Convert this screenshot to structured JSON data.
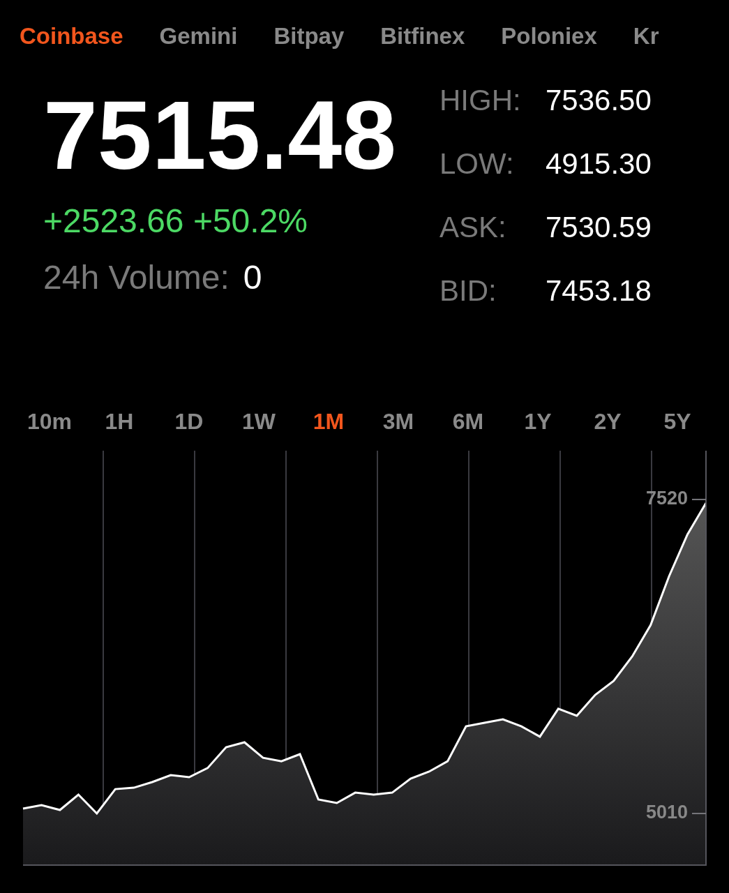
{
  "exchanges": [
    {
      "label": "Coinbase",
      "selected": true
    },
    {
      "label": "Gemini",
      "selected": false
    },
    {
      "label": "Bitpay",
      "selected": false
    },
    {
      "label": "Bitfinex",
      "selected": false
    },
    {
      "label": "Poloniex",
      "selected": false
    },
    {
      "label": "Kr",
      "selected": false
    }
  ],
  "price": "7515.48",
  "change": "+2523.66 +50.2%",
  "volume": {
    "label": "24h Volume:",
    "value": "0"
  },
  "stats": [
    {
      "label": "HIGH:",
      "value": "7536.50"
    },
    {
      "label": "LOW:",
      "value": "4915.30"
    },
    {
      "label": "ASK:",
      "value": "7530.59"
    },
    {
      "label": "BID:",
      "value": "7453.18"
    }
  ],
  "ranges": [
    {
      "label": "10m",
      "selected": false
    },
    {
      "label": "1H",
      "selected": false
    },
    {
      "label": "1D",
      "selected": false
    },
    {
      "label": "1W",
      "selected": false
    },
    {
      "label": "1M",
      "selected": true
    },
    {
      "label": "3M",
      "selected": false
    },
    {
      "label": "6M",
      "selected": false
    },
    {
      "label": "1Y",
      "selected": false
    },
    {
      "label": "2Y",
      "selected": false
    },
    {
      "label": "5Y",
      "selected": false
    }
  ],
  "chart": {
    "chart_data": {
      "type": "area",
      "ylim": [
        4592,
        7910
      ],
      "yticks": [
        7520,
        5010
      ],
      "grid": true,
      "series": [
        {
          "color": "#ffffff",
          "values": [
            5049,
            5077,
            5038,
            5161,
            5010,
            5205,
            5216,
            5261,
            5317,
            5300,
            5373,
            5540,
            5579,
            5456,
            5428,
            5484,
            5122,
            5094,
            5177,
            5161,
            5177,
            5289,
            5345,
            5428,
            5707,
            5735,
            5763,
            5707,
            5624,
            5847,
            5791,
            5958,
            6070,
            6265,
            6516,
            6906,
            7241,
            7492
          ]
        }
      ]
    }
  }
}
